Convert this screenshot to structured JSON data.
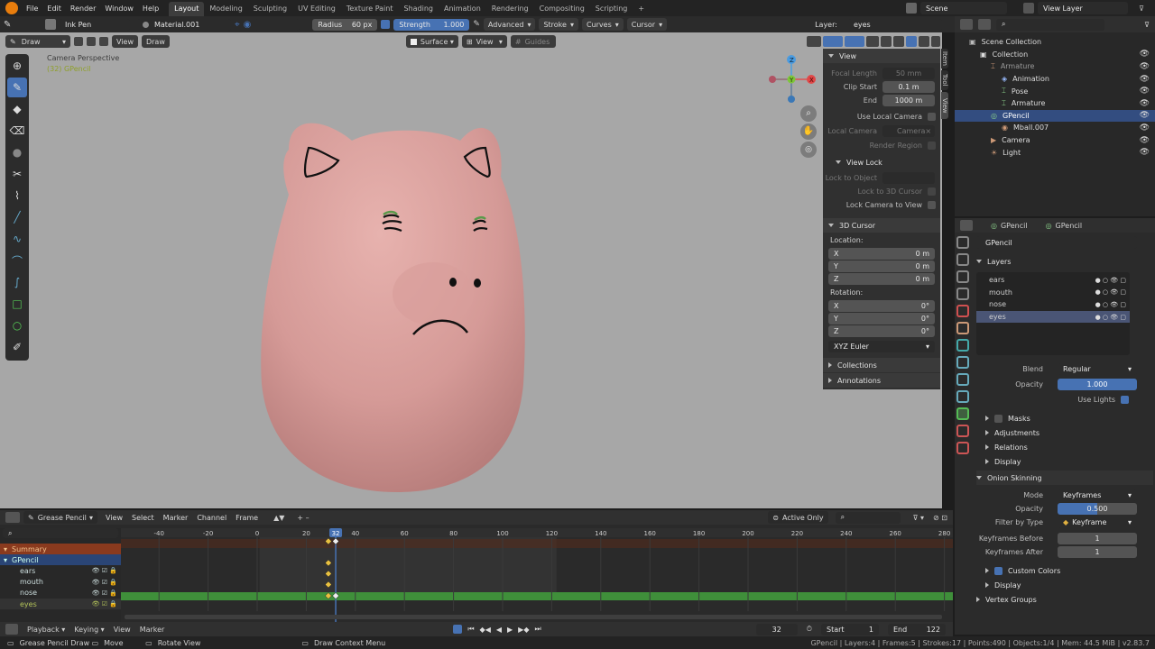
{
  "topbar": {
    "menus": [
      "File",
      "Edit",
      "Render",
      "Window",
      "Help"
    ],
    "workspaces": [
      "Layout",
      "Modeling",
      "Sculpting",
      "UV Editing",
      "Texture Paint",
      "Shading",
      "Animation",
      "Rendering",
      "Compositing",
      "Scripting"
    ],
    "add_tab": "+",
    "scene": "Scene",
    "view_layer": "View Layer"
  },
  "toolheader": {
    "brush": "Ink Pen",
    "material": "Material.001",
    "radius_label": "Radius",
    "radius_value": "60 px",
    "strength_label": "Strength",
    "strength_value": "1.000",
    "advanced": "Advanced",
    "stroke": "Stroke",
    "curves": "Curves",
    "cursor": "Cursor",
    "layer_label": "Layer:",
    "layer_value": "eyes"
  },
  "viewport_header": {
    "mode": "Draw",
    "view": "View",
    "draw": "Draw",
    "placement": "Surface",
    "orient": "View",
    "guides": "Guides"
  },
  "viewport": {
    "camera_label": "Camera Perspective",
    "object_label": "(32) GPencil"
  },
  "npanel": {
    "tabs": [
      "Item",
      "Tool",
      "View"
    ],
    "view_title": "View",
    "focal_length_label": "Focal Length",
    "focal_length": "50 mm",
    "clip_start_label": "Clip Start",
    "clip_start": "0.1 m",
    "end_label": "End",
    "clip_end": "1000 m",
    "use_local_camera": "Use Local Camera",
    "local_camera_label": "Local Camera",
    "local_camera": "Camera",
    "render_region": "Render Region",
    "view_lock_title": "View Lock",
    "lock_to_object": "Lock to Object",
    "lock_to_cursor": "Lock to 3D Cursor",
    "lock_camera": "Lock Camera to View",
    "cursor_title": "3D Cursor",
    "location_label": "Location:",
    "loc": [
      {
        "axis": "X",
        "val": "0 m"
      },
      {
        "axis": "Y",
        "val": "0 m"
      },
      {
        "axis": "Z",
        "val": "0 m"
      }
    ],
    "rotation_label": "Rotation:",
    "rot": [
      {
        "axis": "X",
        "val": "0°"
      },
      {
        "axis": "Y",
        "val": "0°"
      },
      {
        "axis": "Z",
        "val": "0°"
      }
    ],
    "rot_mode": "XYZ Euler",
    "collections": "Collections",
    "annotations": "Annotations"
  },
  "outliner": {
    "items": [
      {
        "label": "Scene Collection",
        "indent": 0
      },
      {
        "label": "Collection",
        "indent": 1
      },
      {
        "label": "Armature",
        "indent": 2
      },
      {
        "label": "Animation",
        "indent": 3
      },
      {
        "label": "Pose",
        "indent": 3
      },
      {
        "label": "Armature",
        "indent": 3
      },
      {
        "label": "GPencil",
        "indent": 2
      },
      {
        "label": "Mball.007",
        "indent": 3
      },
      {
        "label": "Camera",
        "indent": 2
      },
      {
        "label": "Light",
        "indent": 2
      }
    ]
  },
  "properties": {
    "crumb1": "GPencil",
    "crumb2": "GPencil",
    "name": "GPencil",
    "layers_title": "Layers",
    "layers": [
      "ears",
      "mouth",
      "nose",
      "eyes"
    ],
    "blend_label": "Blend",
    "blend": "Regular",
    "opacity_label": "Opacity",
    "opacity": "1.000",
    "use_lights": "Use Lights",
    "masks": "Masks",
    "adjustments": "Adjustments",
    "relations": "Relations",
    "display": "Display",
    "onion_title": "Onion Skinning",
    "mode_label": "Mode",
    "mode": "Keyframes",
    "onion_opacity": "0.500",
    "filter_label": "Filter by Type",
    "filter": "Keyframe",
    "before_label": "Keyframes Before",
    "before": "1",
    "after_label": "Keyframes After",
    "after": "1",
    "custom_colors": "Custom Colors",
    "display2": "Display",
    "vertex_groups": "Vertex Groups"
  },
  "dopesheet": {
    "mode": "Grease Pencil",
    "menus": [
      "View",
      "Select",
      "Marker",
      "Channel",
      "Frame"
    ],
    "active_only": "Active Only",
    "ruler": [
      "-40",
      "-20",
      "0",
      "20",
      "40",
      "60",
      "80",
      "100",
      "120",
      "140",
      "160",
      "180",
      "200",
      "220",
      "240",
      "260",
      "280"
    ],
    "current_frame": "32",
    "channels": [
      "Summary",
      "GPencil",
      "ears",
      "mouth",
      "nose",
      "eyes"
    ]
  },
  "timeline": {
    "playback": "Playback",
    "keying": "Keying",
    "view": "View",
    "marker": "Marker",
    "frame": "32",
    "start_label": "Start",
    "start": "1",
    "end_label": "End",
    "end": "122"
  },
  "statusbar": {
    "left1": "Grease Pencil Draw",
    "left2": "Move",
    "left3": "Rotate View",
    "mid": "Draw Context Menu",
    "right": "GPencil | Layers:4 | Frames:5 | Strokes:17 | Points:490 | Objects:1/4 | Mem: 44.5 MiB | v2.83.7"
  },
  "colors": {
    "accent": "#4772b3",
    "green_track": "#3f8f3a",
    "summary": "#8a3a1e",
    "pig": "#d8a3a0"
  }
}
